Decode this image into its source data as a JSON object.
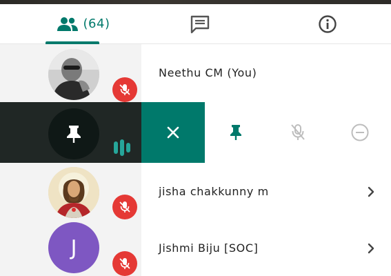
{
  "tabs": {
    "people_count": "(64)",
    "active_tab": "people",
    "accent_color": "#00796b"
  },
  "participants": [
    {
      "name": "Neethu CM (You)",
      "muted": true,
      "avatar": "photo-man-glasses"
    },
    {
      "name": "",
      "selected": true,
      "speaking": true,
      "avatar": "pin-icon"
    },
    {
      "name": "jisha chakkunny m",
      "muted": true,
      "avatar": "photo-religious-portrait"
    },
    {
      "name": "Jishmi Biju [SOC]",
      "muted": true,
      "avatar_initial": "J",
      "avatar_color": "#7e57c2"
    }
  ],
  "row_actions": {
    "close": "close-icon",
    "pin": "pin-icon",
    "mute": "mic-off-icon",
    "remove": "remove-icon"
  },
  "colors": {
    "muted_badge": "#e53935",
    "selected_row_bg": "#202725",
    "speaking_indicator": "#26a69a"
  }
}
